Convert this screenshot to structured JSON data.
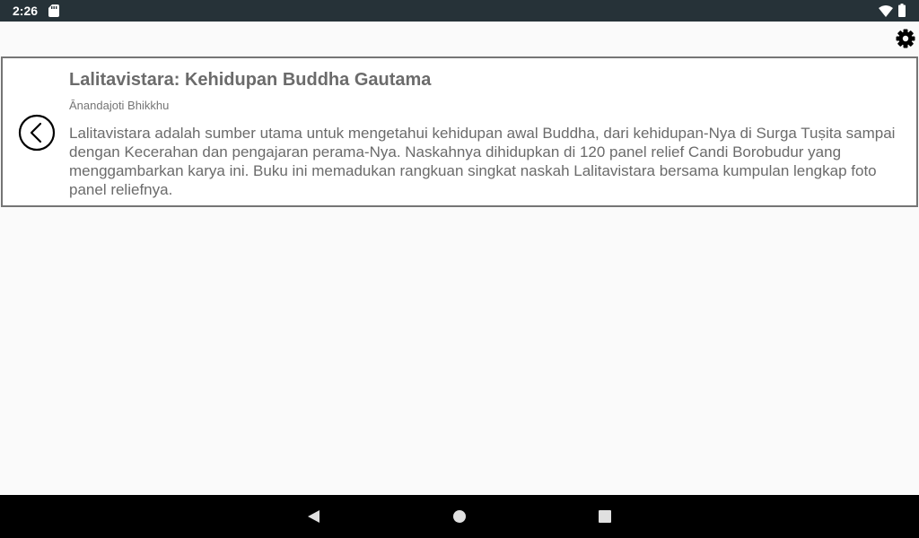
{
  "status_bar": {
    "time": "2:26",
    "icons": [
      "sd-card-icon",
      "wifi-icon",
      "battery-icon"
    ]
  },
  "toolbar": {
    "settings_icon": "gear-icon"
  },
  "book": {
    "title": "Lalitavistara: Kehidupan Buddha Gautama",
    "author": "Ānandajoti Bhikkhu",
    "description": "Lalitavistara adalah sumber utama untuk mengetahui kehidupan awal Buddha, dari kehidupan-Nya di Surga Tuṣita sampai dengan Kecerahan dan pengajaran perama-Nya. Naskahnya dihidupkan di 120 panel relief Candi Borobudur yang menggambarkan karya ini. Buku ini memadukan rangkuan singkat naskah Lalitavistara bersama kumpulan lengkap foto panel reliefnya.",
    "back_icon": "chevron-left-circle-icon"
  },
  "nav_bar": {
    "icons": [
      "back-triangle-icon",
      "home-circle-icon",
      "recents-square-icon"
    ]
  },
  "colors": {
    "status_bar": "#263238",
    "background": "#fafafa",
    "card_border": "#757575",
    "text": "#6b6b6b",
    "nav_bar": "#000000"
  }
}
